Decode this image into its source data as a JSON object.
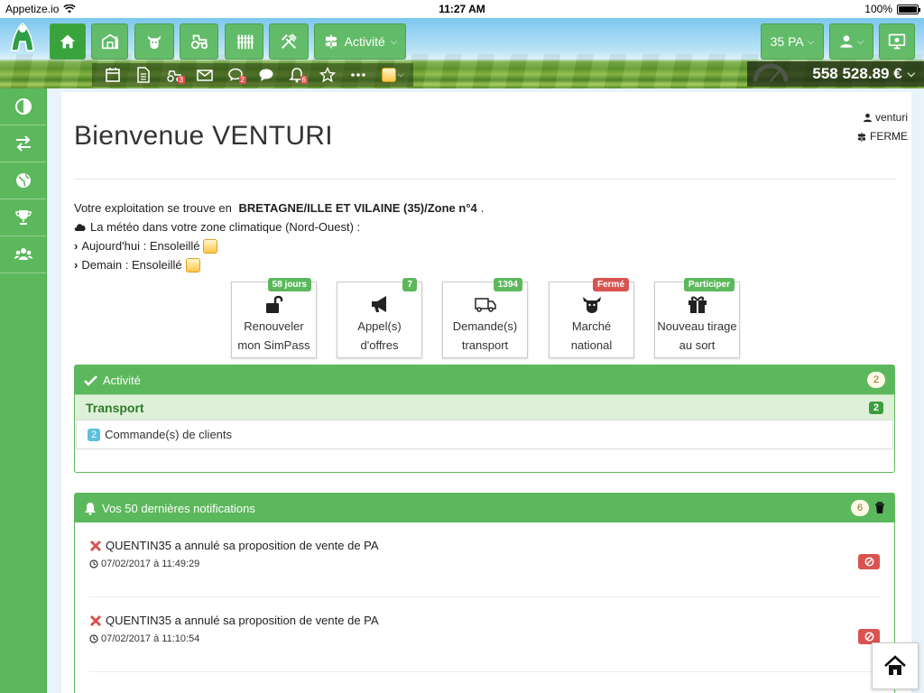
{
  "statusbar": {
    "carrier": "Appetize.io",
    "time": "11:27 AM",
    "battery": "100%"
  },
  "header": {
    "activity_label": "Activité",
    "pa_label": "35 PA",
    "balance": "558 528.89 €",
    "sub_badges": {
      "tractor": "3",
      "chat": "2",
      "bell": "6"
    }
  },
  "page": {
    "title": "Bienvenue VENTURI",
    "user_name": "venturi",
    "user_role": "FERME",
    "location_prefix": "Votre exploitation se trouve en ",
    "location_value": "BRETAGNE/ILLE ET VILAINE (35)/Zone n°4",
    "location_suffix": ".",
    "weather_intro": "La météo dans votre zone climatique (Nord-Ouest) :",
    "weather_today": "Aujourd'hui : Ensoleillé",
    "weather_tomorrow": "Demain : Ensoleillé"
  },
  "tiles": [
    {
      "line1": "Renouveler",
      "line2": "mon SimPass",
      "badge": "58 jours",
      "badge_color": "#5cb85c",
      "icon": "unlock-icon"
    },
    {
      "line1": "Appel(s)",
      "line2": "d'offres",
      "badge": "7",
      "badge_color": "#5cb85c",
      "icon": "megaphone-icon"
    },
    {
      "line1": "Demande(s)",
      "line2": "transport",
      "badge": "1394",
      "badge_color": "#5cb85c",
      "icon": "truck-icon"
    },
    {
      "line1": "Marché",
      "line2": "national",
      "badge": "Fermé",
      "badge_color": "#d9534f",
      "icon": "cow-icon"
    },
    {
      "line1": "Nouveau tirage",
      "line2": "au sort",
      "badge": "Participer",
      "badge_color": "#5cb85c",
      "icon": "gift-icon"
    }
  ],
  "activity": {
    "title": "Activité",
    "count": "2",
    "section_title": "Transport",
    "section_count": "2",
    "row_badge": "2",
    "row_label": "Commande(s) de clients"
  },
  "notifications": {
    "title": "Vos 50 dernières notifications",
    "count": "6",
    "items": [
      {
        "message": "QUENTIN35 a annulé sa proposition de vente de PA",
        "date": "07/02/2017 à 11:49:29"
      },
      {
        "message": "QUENTIN35 a annulé sa proposition de vente de PA",
        "date": "07/02/2017 à 11:10:54"
      }
    ]
  },
  "colors": {
    "primary_green": "#5cb85c",
    "danger_red": "#d9534f",
    "info_blue": "#5bc0de"
  }
}
